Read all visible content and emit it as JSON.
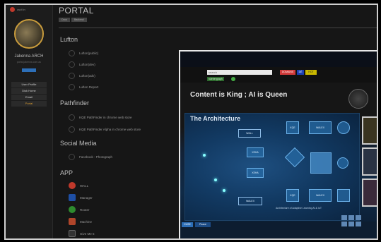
{
  "sidebar": {
    "title": "asdf.in",
    "username": "Jakenna ARCH",
    "subtitle": "portal.jakenna.com.au",
    "menu": [
      {
        "label": "User Profile",
        "active": false
      },
      {
        "label": "Disk Home",
        "active": false
      },
      {
        "label": "Email",
        "active": false
      },
      {
        "label": "Portal",
        "active": true
      }
    ]
  },
  "main": {
    "title": "PORTAL",
    "tabs": [
      "Docs",
      "Backend"
    ],
    "sections": [
      {
        "heading": "Lufton",
        "items": [
          "Lufton(public)",
          "Lufton(dev)",
          "Lufton(adv)",
          "Lufton Report"
        ]
      },
      {
        "heading": "Pathfinder",
        "items": [
          "KQE PathFinder in chrome web store",
          "KQE PathFinder Alpha in chrome web store"
        ]
      },
      {
        "heading": "Social Media",
        "items": [
          "Facebook - Photograph"
        ]
      },
      {
        "heading": "APP",
        "items": [
          "WALL",
          "Manager",
          "Router",
          "Machine",
          "Give Me 5"
        ]
      }
    ],
    "app_icon_colors": [
      "#c0392b",
      "#1e4fa5",
      "#2e8b2e",
      "#b0452a",
      "#333333"
    ]
  },
  "overlay": {
    "search_placeholder": "search",
    "chips": [
      "DOMAINS",
      "DÉ",
      "HOT"
    ],
    "tag": "rulebergraph",
    "headline": "Content is King ; AI is Queen",
    "arch_title": "The Architecture",
    "arch_caption": "Architecture of Adaptive Learning AI & IoT",
    "nodes": [
      "WALL",
      "WALEX",
      "KQE",
      "XEHA",
      "WALEX"
    ],
    "bottom_buttons": [
      "CUSE",
      "Peace"
    ],
    "colors": {
      "accent_blue": "#2d6fb8",
      "chip_red": "#d23b3b",
      "chip_blue": "#1b3fb3",
      "chip_yellow": "#c9b800"
    }
  }
}
